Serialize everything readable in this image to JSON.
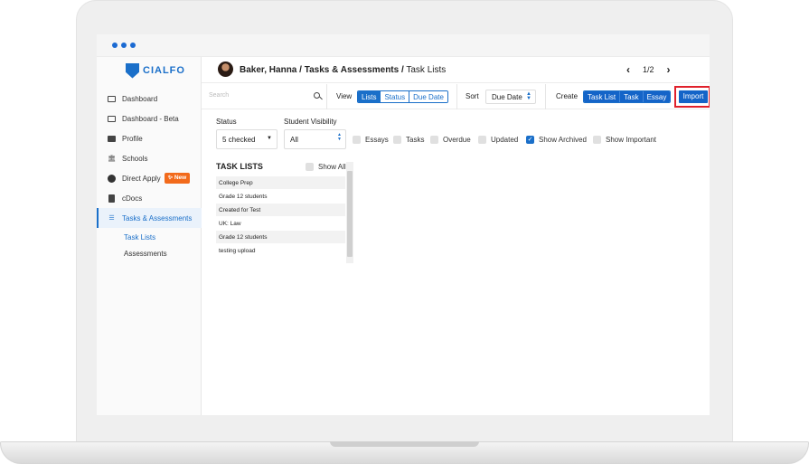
{
  "sidebar": {
    "logo": "CIALFO",
    "items": [
      {
        "label": "Dashboard",
        "icon": "dashboard-icon"
      },
      {
        "label": "Dashboard - Beta",
        "icon": "dashboard-icon"
      },
      {
        "label": "Profile",
        "icon": "id-card-icon"
      },
      {
        "label": "Schools",
        "icon": "building-icon"
      },
      {
        "label": "Direct Apply",
        "icon": "direct-apply-icon",
        "badge": "New"
      },
      {
        "label": "cDocs",
        "icon": "document-icon"
      },
      {
        "label": "Tasks & Assessments",
        "icon": "list-icon"
      }
    ],
    "subitems": [
      {
        "label": "Task Lists"
      },
      {
        "label": "Assessments"
      }
    ]
  },
  "header": {
    "breadcrumb_bold": "Baker, Hanna / Tasks & Assessments /",
    "breadcrumb_current": " Task Lists",
    "pager": "1/2"
  },
  "toolbar": {
    "search_placeholder": "Search",
    "view_label": "View",
    "view_options": [
      "Lists",
      "Status",
      "Due Date"
    ],
    "sort_label": "Sort",
    "sort_value": "Due Date",
    "create_label": "Create",
    "create_options": [
      "Task List",
      "Task",
      "Essay"
    ],
    "import_label": "Import"
  },
  "filters": {
    "status_label": "Status",
    "status_value": "5 checked",
    "visibility_label": "Student Visibility",
    "visibility_value": "All",
    "checkboxes": [
      {
        "label": "Essays",
        "checked": false
      },
      {
        "label": "Tasks",
        "checked": false
      },
      {
        "label": "Overdue",
        "checked": false
      },
      {
        "label": "Updated",
        "checked": false
      },
      {
        "label": "Show Archived",
        "checked": true
      },
      {
        "label": "Show Important",
        "checked": false
      }
    ]
  },
  "task_lists": {
    "title": "TASK LISTS",
    "show_all": "Show All",
    "rows": [
      "College Prep",
      "Grade 12 students",
      "Created for Test",
      "UK: Law",
      "Grade 12 students",
      "testing upload"
    ]
  },
  "colors": {
    "accent": "#1a6fc9",
    "badge": "#f26a1b",
    "highlight": "#e0202b"
  }
}
